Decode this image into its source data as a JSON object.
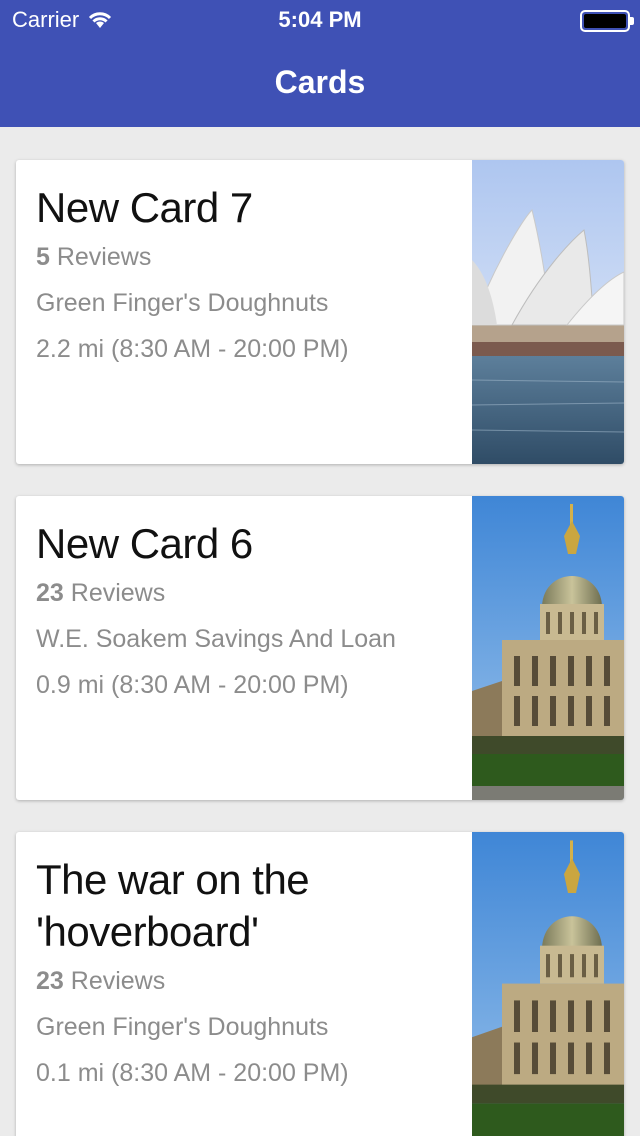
{
  "status_bar": {
    "carrier": "Carrier",
    "time": "5:04 PM"
  },
  "nav": {
    "title": "Cards"
  },
  "cards": [
    {
      "title": "New Card 7",
      "review_count": "5",
      "reviews_label": " Reviews",
      "business": "Green Finger's Doughnuts",
      "details": "2.2 mi (8:30 AM - 20:00 PM)",
      "image": "sydney-opera-house"
    },
    {
      "title": "New Card 6",
      "review_count": "23",
      "reviews_label": " Reviews",
      "business": "W.E. Soakem Savings And Loan",
      "details": "0.9 mi (8:30 AM - 20:00 PM)",
      "image": "les-invalides-dome"
    },
    {
      "title": "The war on the 'hoverboard'",
      "review_count": "23",
      "reviews_label": " Reviews",
      "business": "Green Finger's Doughnuts",
      "details": "0.1 mi (8:30 AM - 20:00 PM)",
      "image": "les-invalides-dome"
    }
  ],
  "colors": {
    "nav_bar": "#3f51b5",
    "background": "#ebebeb",
    "secondary_text": "#8c8c8c"
  }
}
